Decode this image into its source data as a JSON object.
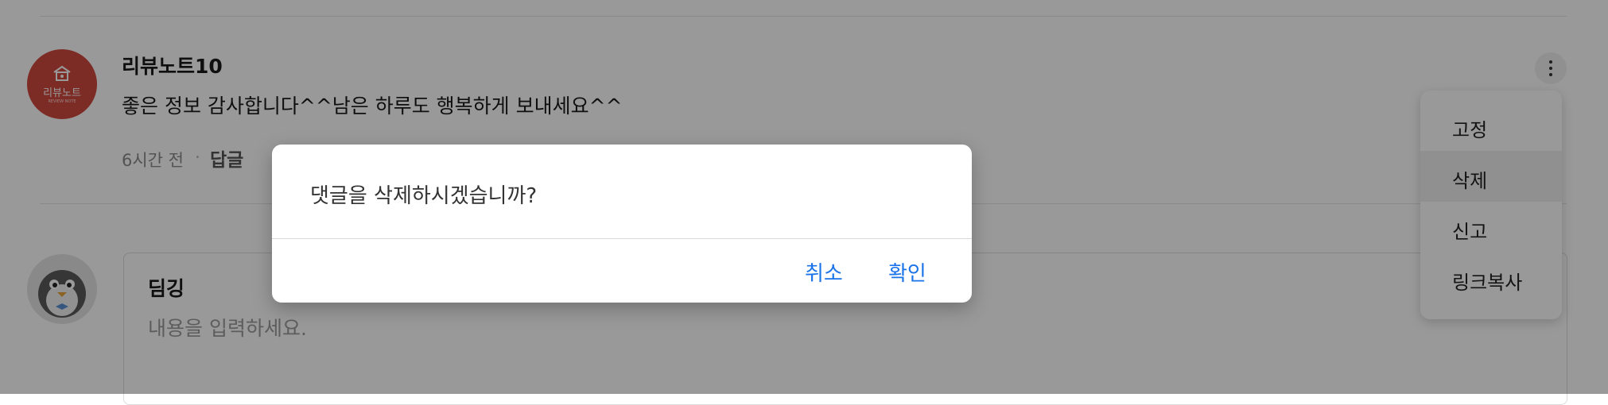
{
  "comment": {
    "author": "리뷰노트10",
    "text": "좋은 정보 감사합니다^^남은 하루도 행복하게 보내세요^^",
    "time": "6시간 전",
    "separator": "·",
    "reply_label": "답글",
    "avatar_logo_text": "리뷰노트",
    "avatar_logo_sub": "REVIEW NOTE",
    "more_icon": "more-vertical-icon"
  },
  "context_menu": {
    "items": [
      {
        "label": "고정"
      },
      {
        "label": "삭제",
        "highlighted": true
      },
      {
        "label": "신고"
      },
      {
        "label": "링크복사"
      }
    ]
  },
  "editor": {
    "name": "딤깅",
    "placeholder": "내용을 입력하세요.",
    "avatar_icon": "penguin-avatar-icon"
  },
  "dialog": {
    "message": "댓글을 삭제하시겠습니까?",
    "cancel_label": "취소",
    "confirm_label": "확인"
  },
  "colors": {
    "overlay": "#000000",
    "button_text": "#1a73e8",
    "brand_avatar": "#d0483f"
  }
}
